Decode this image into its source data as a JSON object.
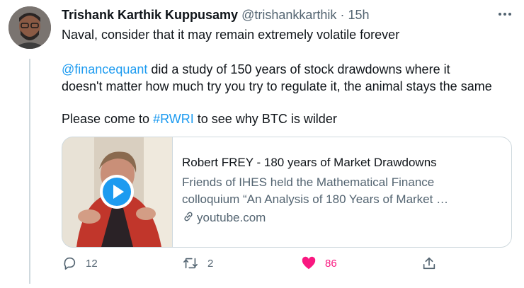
{
  "tweet": {
    "author_name": "Trishank Karthik Kuppusamy",
    "handle": "@trishankkarthik",
    "separator": "·",
    "time": "15h",
    "line1": "Naval, consider that it may remain extremely volatile forever",
    "mention": "@financequant",
    "line2_rest": " did a study of 150 years of stock drawdowns where it",
    "line3": "doesn't matter how much try you try to regulate it, the animal stays the same",
    "line4_prefix": "Please come to ",
    "hashtag": "#RWRI",
    "line4_suffix": " to see why BTC is wilder"
  },
  "card": {
    "title": "Robert FREY - 180 years of Market Drawdowns",
    "desc_line1": "Friends of IHES held the Mathematical Finance",
    "desc_line2": "colloquium “An Analysis of 180 Years of Market …",
    "domain": "youtube.com"
  },
  "actions": {
    "reply_count": "12",
    "retweet_count": "2",
    "like_count": "86",
    "share_count": ""
  },
  "colors": {
    "link": "#1d9bf0",
    "like": "#f91880",
    "muted": "#536471"
  },
  "icons": [
    "more-icon",
    "play-icon",
    "link-icon",
    "reply-icon",
    "retweet-icon",
    "heart-icon",
    "share-icon"
  ]
}
